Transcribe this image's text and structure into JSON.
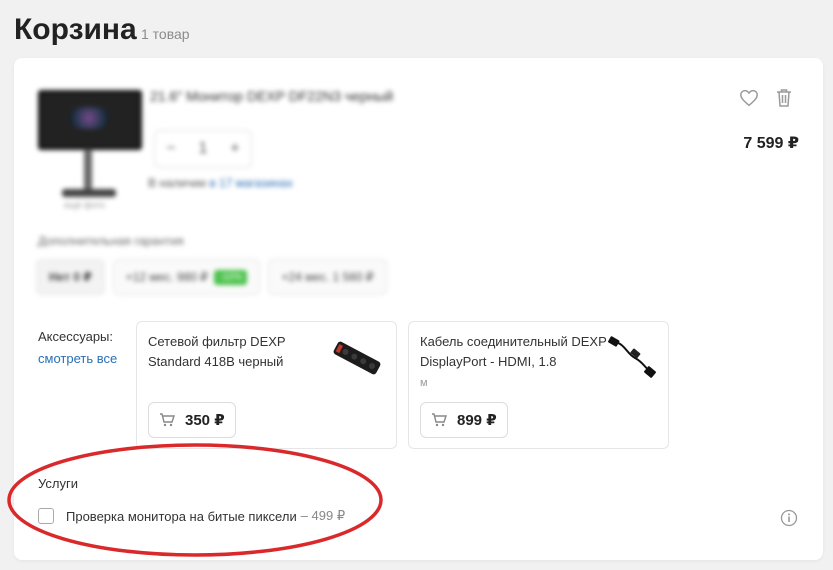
{
  "header": {
    "title": "Корзина",
    "count": "1 товар"
  },
  "product": {
    "name": "21.6\" Монитор DEXP DF22N3 черный",
    "quantity": "1",
    "qty_minus": "−",
    "qty_plus": "+",
    "availability_prefix": "В наличии ",
    "availability_link": "в 17 магазинах",
    "price": "7 599 ₽",
    "image_caption": "ещё фото"
  },
  "warranty": {
    "label": "Дополнительная гарантия",
    "options": [
      {
        "label": "Нет 0 ₽",
        "selected": true
      },
      {
        "label": "+12 мес. 980 ₽",
        "badge": "-10%"
      },
      {
        "label": "+24 мес. 1 560 ₽"
      }
    ]
  },
  "accessories": {
    "label": "Аксессуары:",
    "link": "смотреть все",
    "items": [
      {
        "title": "Сетевой фильтр DEXP Standard 418B черный",
        "price": "350 ₽"
      },
      {
        "title": "Кабель соединительный DEXP DisplayPort - HDMI, 1.8",
        "title_tail": "м",
        "price": "899 ₽"
      }
    ]
  },
  "services": {
    "label": "Услуги",
    "items": [
      {
        "name": "Проверка монитора на битые пиксели",
        "price": "– 499 ₽",
        "checked": false
      }
    ]
  },
  "colors": {
    "annotation": "#d9292b",
    "link": "#2a6fb5",
    "badge": "#48c148"
  },
  "icons": [
    "heart-icon",
    "trash-icon",
    "cart-icon",
    "info-icon",
    "checkbox"
  ]
}
